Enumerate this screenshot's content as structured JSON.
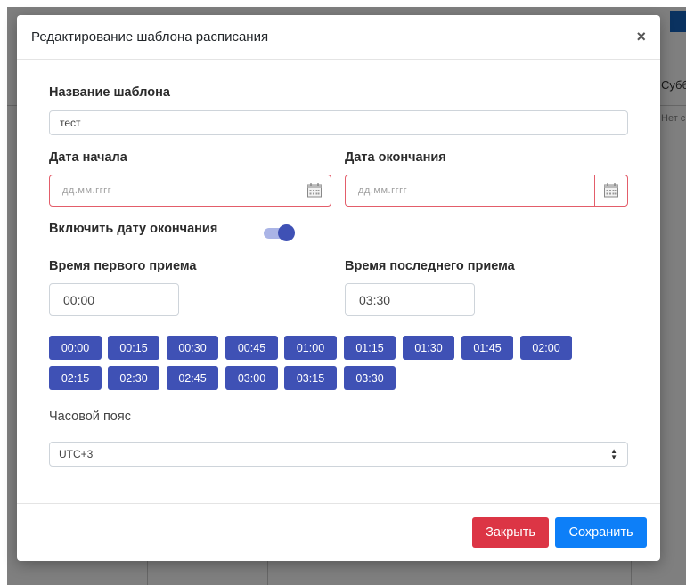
{
  "background": {
    "day_label": "Субб",
    "small_text": "Нет с"
  },
  "modal": {
    "title": "Редактирование шаблона расписания",
    "close_icon": "close-icon",
    "template_name": {
      "label": "Название шаблона",
      "value": "тест"
    },
    "start_date": {
      "label": "Дата начала",
      "placeholder": "дд.мм.гггг",
      "icon": "calendar-icon"
    },
    "end_date": {
      "label": "Дата окончания",
      "placeholder": "дд.мм.гггг",
      "icon": "calendar-icon"
    },
    "enable_end_date": {
      "label": "Включить дату окончания",
      "checked": true
    },
    "first_time": {
      "label": "Время первого приема",
      "value": "00:00"
    },
    "last_time": {
      "label": "Время последнего приема",
      "value": "03:30"
    },
    "time_slots": [
      "00:00",
      "00:15",
      "00:30",
      "00:45",
      "01:00",
      "01:15",
      "01:30",
      "01:45",
      "02:00",
      "02:15",
      "02:30",
      "02:45",
      "03:00",
      "03:15",
      "03:30"
    ],
    "timezone": {
      "label": "Часовой пояс",
      "value": "UTC+3"
    },
    "buttons": {
      "close": "Закрыть",
      "save": "Сохранить"
    }
  },
  "colors": {
    "primary_chip": "#3f51b5",
    "danger": "#dc3545",
    "primary": "#0d7ff8",
    "invalid_border": "#e35d6a"
  }
}
